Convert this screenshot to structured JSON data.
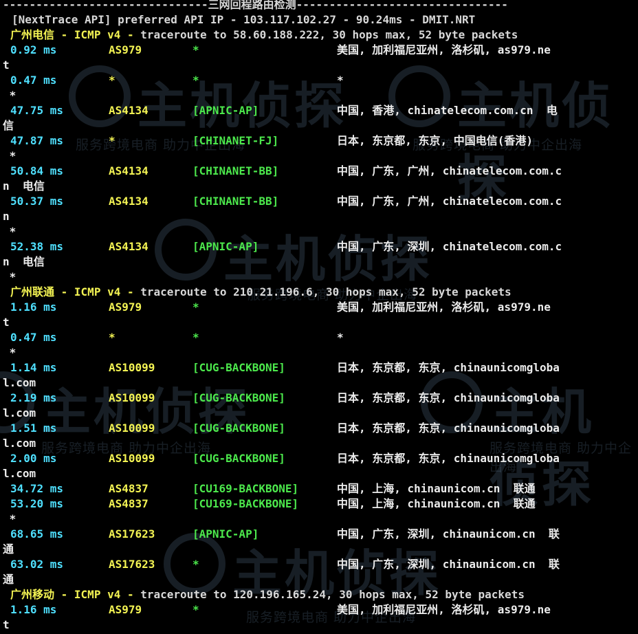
{
  "header": {
    "title_line": "-------------------------------三网回程路由检测--------------------------------",
    "api_line": "[NextTrace API] preferred API IP - 103.117.102.27 - 90.24ms - DMIT.NRT"
  },
  "watermark": {
    "logo_text": "主机侦探",
    "sub_text": "服务跨境电商 助力中企出海"
  },
  "sections": [
    {
      "name": "广州电信",
      "proto": " - ICMP v4 - ",
      "rest": "traceroute to 58.60.188.222, 30 hops max, 52 byte packets",
      "hops": [
        {
          "latency": "0.92 ms",
          "asn": "AS979",
          "tag": "*",
          "loc": "美国, 加利福尼亚州, 洛杉矶, as979.ne",
          "wrap": "t"
        },
        {
          "latency": "0.47 ms",
          "asn": "*",
          "tag": "*",
          "loc": "*",
          "wrap": " *"
        },
        {
          "latency": "47.75 ms",
          "asn": "AS4134",
          "tag": "[APNIC-AP]",
          "loc": "中国, 香港, chinatelecom.com.cn  电",
          "wrap": "信"
        },
        {
          "latency": "47.87 ms",
          "asn": "*",
          "tag": "[CHINANET-FJ]",
          "loc": "日本, 东京都, 东京, 中国电信(香港)",
          "wrap": " *"
        },
        {
          "latency": "50.84 ms",
          "asn": "AS4134",
          "tag": "[CHINANET-BB]",
          "loc": "中国, 广东, 广州, chinatelecom.com.c",
          "wrap": "n  电信"
        },
        {
          "latency": "50.37 ms",
          "asn": "AS4134",
          "tag": "[CHINANET-BB]",
          "loc": "中国, 广东, 广州, chinatelecom.com.c",
          "wrap": "n",
          "extra": " *"
        },
        {
          "latency": "52.38 ms",
          "asn": "AS4134",
          "tag": "[APNIC-AP]",
          "loc": "中国, 广东, 深圳, chinatelecom.com.c",
          "wrap": "n  电信",
          "extra": " *"
        }
      ]
    },
    {
      "name": "广州联通",
      "proto": " - ICMP v4 - ",
      "rest": "traceroute to 210.21.196.6, 30 hops max, 52 byte packets",
      "hops": [
        {
          "latency": "1.16 ms",
          "asn": "AS979",
          "tag": "*",
          "loc": "美国, 加利福尼亚州, 洛杉矶, as979.ne",
          "wrap": "t"
        },
        {
          "latency": "0.47 ms",
          "asn": "*",
          "tag": "*",
          "loc": "*",
          "wrap": " *"
        },
        {
          "latency": "1.14 ms",
          "asn": "AS10099",
          "tag": "[CUG-BACKBONE]",
          "loc": "日本, 东京都, 东京, chinaunicomgloba",
          "wrap": "l.com"
        },
        {
          "latency": "2.19 ms",
          "asn": "AS10099",
          "tag": "[CUG-BACKBONE]",
          "loc": "日本, 东京都, 东京, chinaunicomgloba",
          "wrap": "l.com"
        },
        {
          "latency": "1.51 ms",
          "asn": "AS10099",
          "tag": "[CUG-BACKBONE]",
          "loc": "日本, 东京都, 东京, chinaunicomgloba",
          "wrap": "l.com"
        },
        {
          "latency": "2.00 ms",
          "asn": "AS10099",
          "tag": "[CUG-BACKBONE]",
          "loc": "日本, 东京都, 东京, chinaunicomgloba",
          "wrap": "l.com"
        },
        {
          "latency": "34.72 ms",
          "asn": "AS4837",
          "tag": "[CU169-BACKBONE]",
          "loc": "中国, 上海, chinaunicom.cn  联通"
        },
        {
          "latency": "53.20 ms",
          "asn": "AS4837",
          "tag": "[CU169-BACKBONE]",
          "loc": "中国, 上海, chinaunicom.cn  联通",
          "wrap": " *"
        },
        {
          "latency": "68.65 ms",
          "asn": "AS17623",
          "tag": "[APNIC-AP]",
          "loc": "中国, 广东, 深圳, chinaunicom.cn  联",
          "wrap": "通"
        },
        {
          "latency": "63.02 ms",
          "asn": "AS17623",
          "tag": "*",
          "loc": "中国, 广东, 深圳, chinaunicom.cn  联",
          "wrap": "通"
        }
      ]
    },
    {
      "name": "广州移动",
      "proto": " - ICMP v4 - ",
      "rest": "traceroute to 120.196.165.24, 30 hops max, 52 byte packets",
      "hops": [
        {
          "latency": "1.16 ms",
          "asn": "AS979",
          "tag": "*",
          "loc": "美国, 加利福尼亚州, 洛杉矶, as979.ne",
          "wrap": "t"
        }
      ]
    }
  ]
}
